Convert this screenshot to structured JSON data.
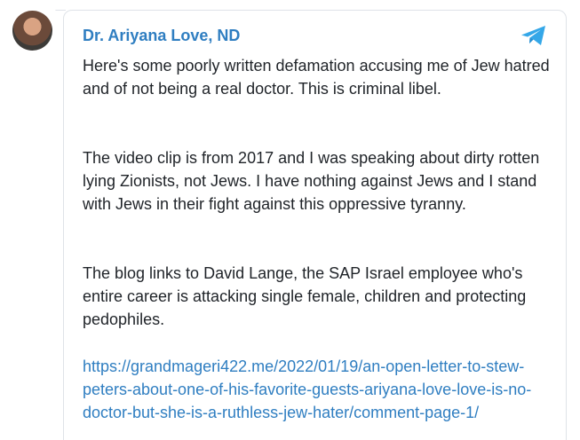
{
  "author": "Dr. Ariyana Love, ND",
  "icons": {
    "avatar": "author-avatar",
    "channel": "telegram-icon"
  },
  "paragraphs": [
    "Here's some poorly written defamation accusing me of Jew hatred and of not being a real doctor. This is criminal libel.",
    "The video clip is from 2017 and I was speaking about dirty rotten lying Zionists, not Jews. I have nothing against Jews and I stand with Jews in their fight against this oppressive tyranny.",
    "The blog links to David Lange, the SAP Israel employee who's entire career is attacking single female, children and protecting pedophiles."
  ],
  "link": "https://grandmageri422.me/2022/01/19/an-open-letter-to-stew-peters-about-one-of-his-favorite-guests-ariyana-love-love-is-no-doctor-but-she-is-a-ruthless-jew-hater/comment-page-1/",
  "colors": {
    "name": "#2f7ec1",
    "link": "#2f7ec1",
    "icon": "#34a7e8",
    "text": "#1f2328"
  }
}
